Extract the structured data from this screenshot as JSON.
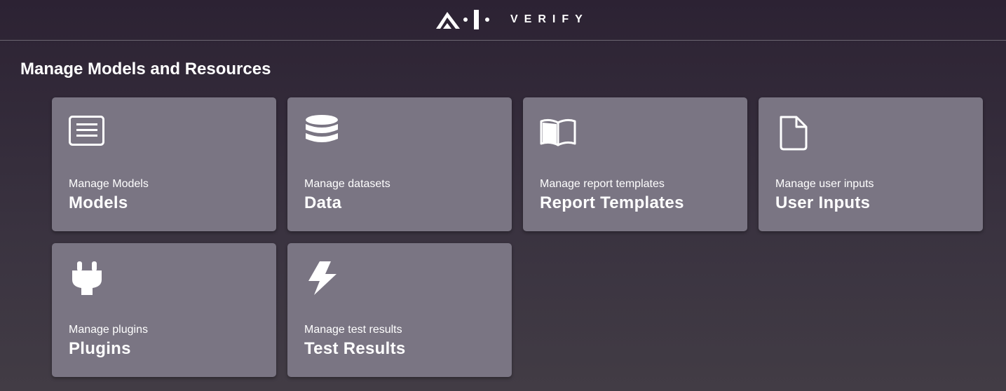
{
  "header": {
    "logo_text": "VERIFY"
  },
  "page": {
    "title": "Manage Models and Resources"
  },
  "cards": [
    {
      "icon": "document-list-icon",
      "subtitle": "Manage Models",
      "title": "Models"
    },
    {
      "icon": "database-icon",
      "subtitle": "Manage datasets",
      "title": "Data"
    },
    {
      "icon": "book-icon",
      "subtitle": "Manage report templates",
      "title": "Report Templates"
    },
    {
      "icon": "file-icon",
      "subtitle": "Manage user inputs",
      "title": "User Inputs"
    },
    {
      "icon": "plug-icon",
      "subtitle": "Manage plugins",
      "title": "Plugins"
    },
    {
      "icon": "lightning-icon",
      "subtitle": "Manage test results",
      "title": "Test Results"
    }
  ],
  "colors": {
    "card_bg": "#7a7583",
    "background": "#2c2233"
  }
}
